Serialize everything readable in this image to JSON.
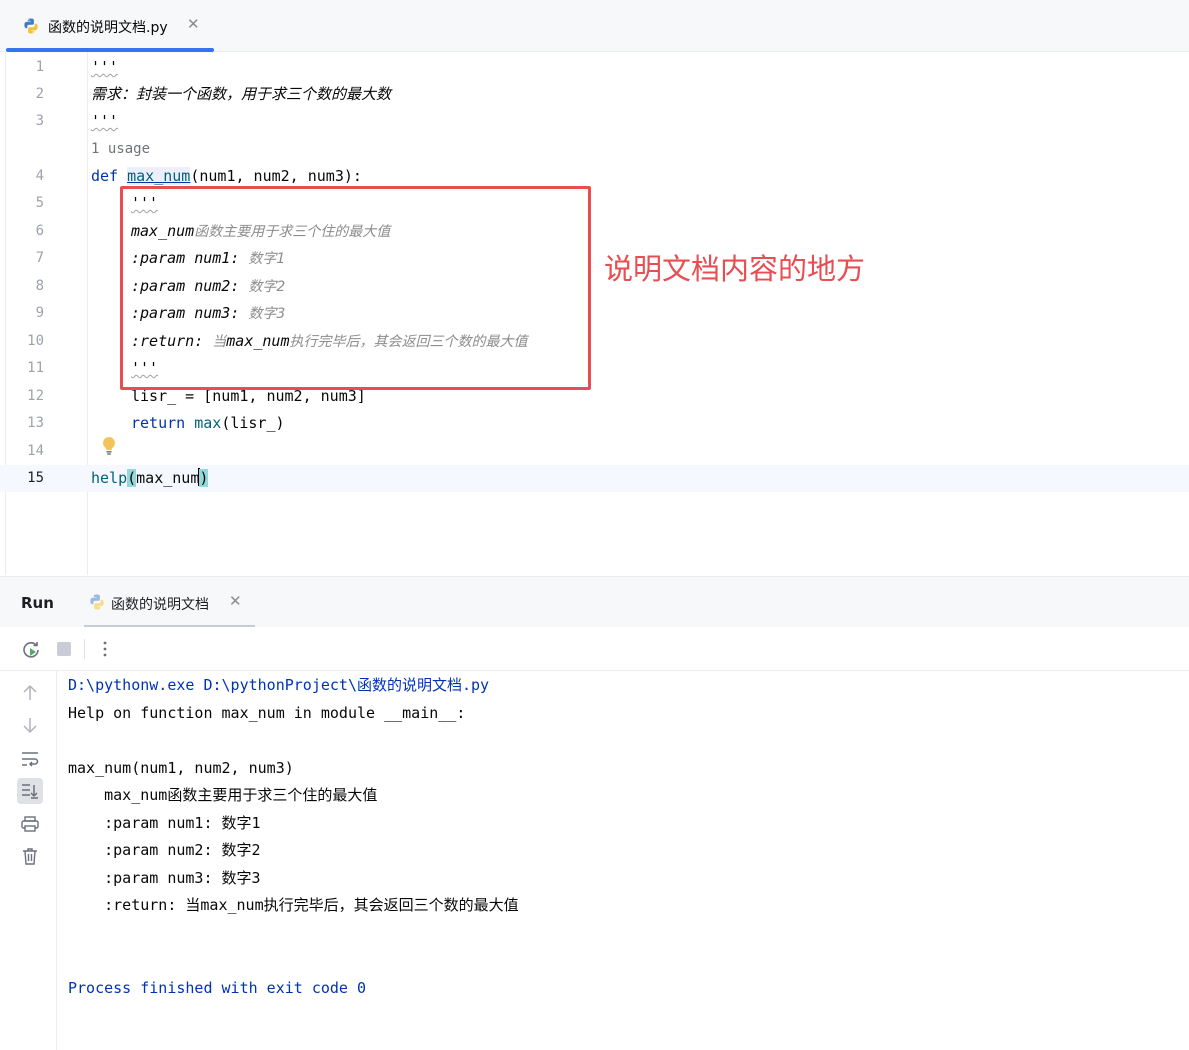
{
  "editor_tab": {
    "filename": "函数的说明文档.py"
  },
  "editor": {
    "line_numbers": [
      "1",
      "2",
      "3",
      "4",
      "5",
      "6",
      "7",
      "8",
      "9",
      "10",
      "11",
      "12",
      "13",
      "14",
      "15"
    ],
    "usage_hint": "1 usage",
    "lines": {
      "l1": "'''",
      "l2": "需求：封装一个函数，用于求三个数的最大数",
      "l3": "'''",
      "l4_def": "def",
      "l4_name": "max_num",
      "l4_rest": "(num1, num2, num3):",
      "l5": "'''",
      "l6_a": "max_num",
      "l6_b": "函数主要用于求三个住的最大值",
      "l7_a": ":param num1: ",
      "l7_b": "数字1",
      "l8_a": ":param num2: ",
      "l8_b": "数字2",
      "l9_a": ":param num3: ",
      "l9_b": "数字3",
      "l10_a": ":return: ",
      "l10_b": "当",
      "l10_c": "max_num",
      "l10_d": "执行完毕后，其会返回三个数的最大值",
      "l11": "'''",
      "l12": "lisr_ = [num1, num2, num3]",
      "l13_kw": "return",
      "l13_fn": "max",
      "l13_rest": "(lisr_)",
      "l15_fn": "help",
      "l15_open": "(",
      "l15_arg": "max_num",
      "l15_close": ")"
    },
    "annotation": "说明文档内容的地方"
  },
  "run_panel": {
    "title": "Run",
    "tab_label": "函数的说明文档",
    "console_lines": [
      "D:\\pythonw.exe D:\\pythonProject\\函数的说明文档.py",
      "Help on function max_num in module __main__:",
      "",
      "max_num(num1, num2, num3)",
      "    max_num函数主要用于求三个住的最大值",
      "    :param num1: 数字1",
      "    :param num2: 数字2",
      "    :param num3: 数字3",
      "    :return: 当max_num执行完毕后，其会返回三个数的最大值",
      "",
      "",
      "Process finished with exit code 0"
    ]
  },
  "colors": {
    "accent": "#3574f0",
    "keyword": "#0033b3",
    "docstring": "#8c8c8c",
    "annotation_red": "#e84d52"
  }
}
